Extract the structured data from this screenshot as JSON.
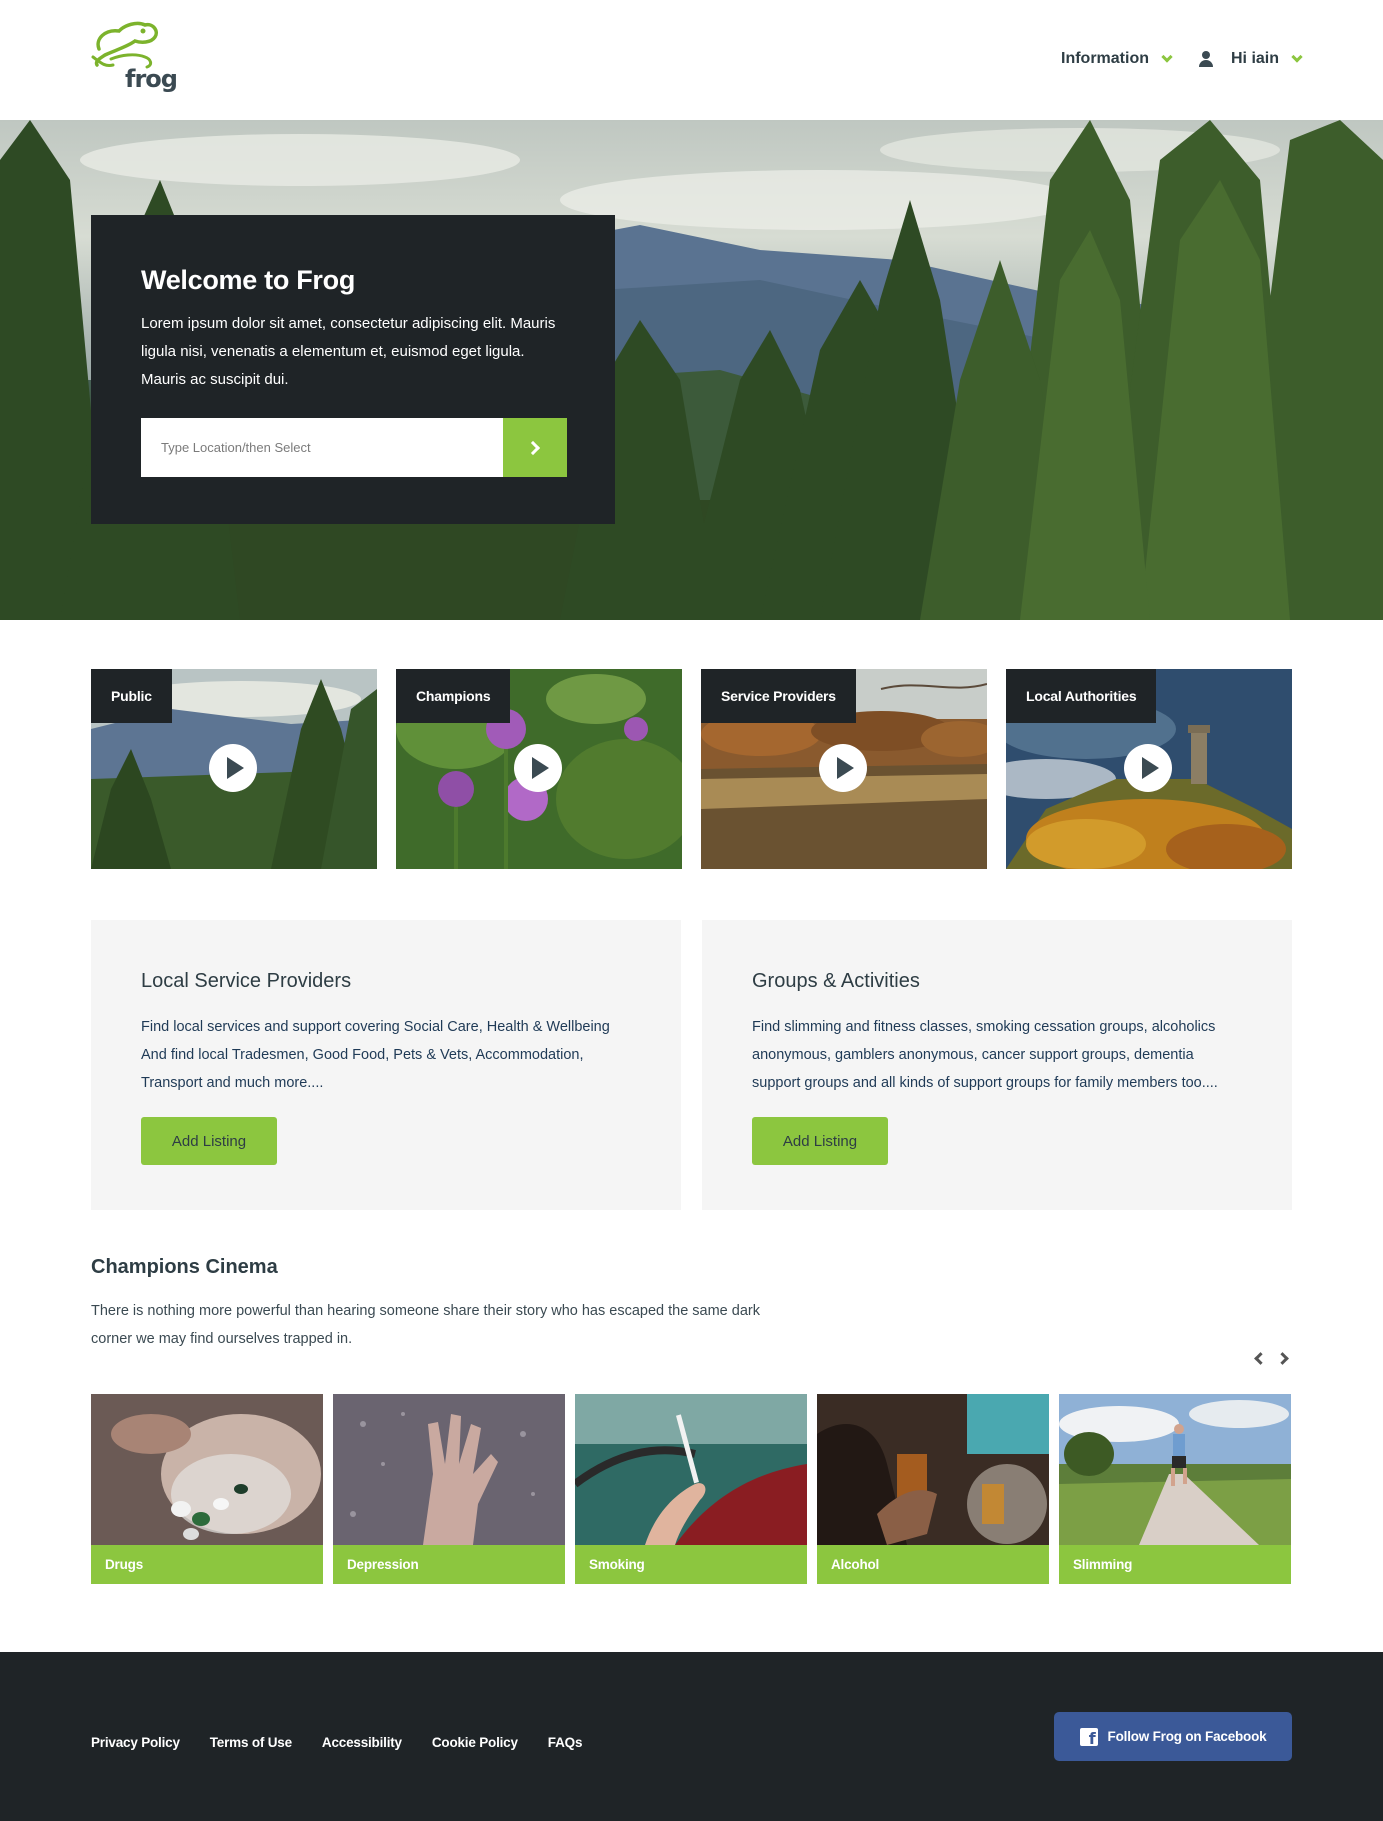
{
  "header": {
    "logo_text": "frog",
    "nav_information": "Information",
    "nav_user": "Hi iain"
  },
  "hero": {
    "title": "Welcome to Frog",
    "text": "Lorem ipsum dolor sit amet, consectetur adipiscing elit. Mauris ligula nisi, venenatis a elementum et, euismod eget ligula. Mauris ac suscipit dui.",
    "search_placeholder": "Type Location/then Select"
  },
  "video_tiles": [
    {
      "label": "Public"
    },
    {
      "label": "Champions"
    },
    {
      "label": "Service Providers"
    },
    {
      "label": "Local Authorities"
    }
  ],
  "info_boxes": [
    {
      "title": "Local Service Providers",
      "text": "Find local services and support covering Social Care, Health & Wellbeing And find local Tradesmen, Good Food, Pets & Vets, Accommodation, Transport and much more....",
      "button": "Add Listing"
    },
    {
      "title": "Groups & Activities",
      "text": "Find slimming and fitness classes, smoking cessation groups, alcoholics anonymous, gamblers anonymous, cancer support groups, dementia support groups and all kinds of support groups for family members too....",
      "button": "Add Listing"
    }
  ],
  "cinema": {
    "title": "Champions Cinema",
    "text": "There is nothing more powerful than hearing someone share their story who has escaped the same dark corner we may find ourselves trapped in.",
    "cards": [
      {
        "label": "Drugs"
      },
      {
        "label": "Depression"
      },
      {
        "label": "Smoking"
      },
      {
        "label": "Alcohol"
      },
      {
        "label": "Slimming"
      }
    ]
  },
  "footer": {
    "links": [
      "Privacy Policy",
      "Terms of Use",
      "Accessibility",
      "Cookie Policy",
      "FAQs"
    ],
    "facebook_button": "Follow Frog on Facebook"
  },
  "colors": {
    "accent_green": "#8cc63f",
    "dark": "#1f2427",
    "facebook_blue": "#3b5998",
    "panel_grey": "#f5f5f5"
  }
}
